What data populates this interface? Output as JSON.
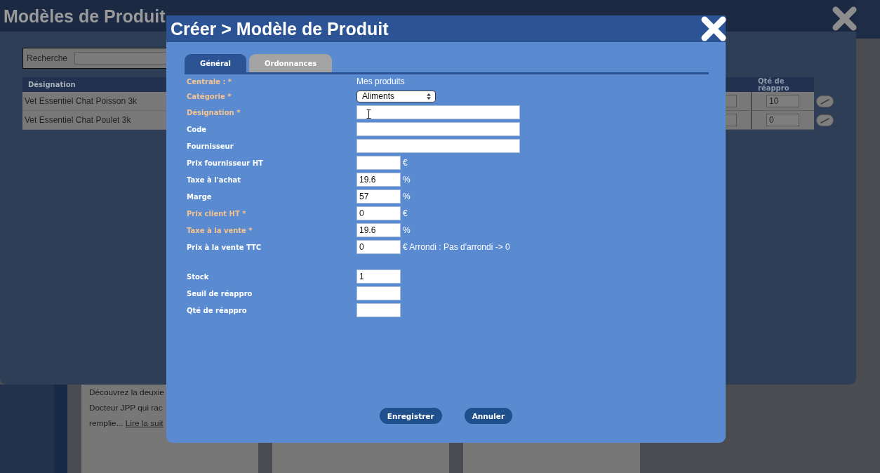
{
  "page": {
    "article": {
      "lines": [
        "Découvrez la deuxie",
        "Docteur JPP qui rac",
        "remplie..."
      ],
      "link": "Lire la suit"
    }
  },
  "background_window": {
    "title": "Modèles de Produit",
    "search": {
      "label": "Recherche"
    },
    "table": {
      "columns": [
        "Désignation",
        "Qté de réappro"
      ],
      "rows": [
        {
          "designation": "Vet Essentiel Chat Poisson 3k",
          "qte_de_reappro": "10"
        },
        {
          "designation": "Vet Essentiel Chat Poulet 3k",
          "qte_de_reappro": "0"
        }
      ]
    }
  },
  "dialog": {
    "title": "Créer > Modèle de Produit",
    "tabs": [
      {
        "label": "Général",
        "selected": true
      },
      {
        "label": "Ordonnances",
        "selected": false
      }
    ],
    "sections": [
      {
        "fields": [
          {
            "kind": "text",
            "label": "Centrale : *",
            "required": true,
            "value": "Mes produits"
          },
          {
            "kind": "select",
            "label": "Catégorie *",
            "required": true,
            "value": "Aliments"
          },
          {
            "kind": "text-input",
            "label": "Désignation *",
            "required": true
          },
          {
            "kind": "text-input",
            "label": "Code",
            "required": false
          },
          {
            "kind": "text-input",
            "label": "Fournisseur",
            "required": false
          },
          {
            "kind": "number-input",
            "label": "Prix fournisseur HT",
            "required": false,
            "unit": "€"
          },
          {
            "kind": "number-input",
            "label": "Taxe à l'achat",
            "required": false,
            "value": "19.6",
            "unit": "%"
          },
          {
            "kind": "number-input",
            "label": "Marge",
            "required": false,
            "value": "57",
            "unit": "%"
          },
          {
            "kind": "number-input",
            "label": "Prix client HT *",
            "required": true,
            "value": "0",
            "unit": "€"
          },
          {
            "kind": "number-input",
            "label": "Taxe à la vente *",
            "required": true,
            "value": "19.6",
            "unit": "%"
          },
          {
            "kind": "number-input",
            "label": "Prix à la vente TTC",
            "required": false,
            "value": "0",
            "unit": "€ Arrondi : Pas d'arrondi -> 0"
          }
        ]
      },
      {
        "fields": [
          {
            "kind": "number-input",
            "label": "Stock",
            "required": false,
            "value": "1"
          },
          {
            "kind": "number-input",
            "label": "Seuil de réappro",
            "required": false
          },
          {
            "kind": "number-input",
            "label": "Qté de réappro",
            "required": false
          }
        ]
      }
    ],
    "buttons": [
      "Enregistrer",
      "Annuler"
    ]
  }
}
